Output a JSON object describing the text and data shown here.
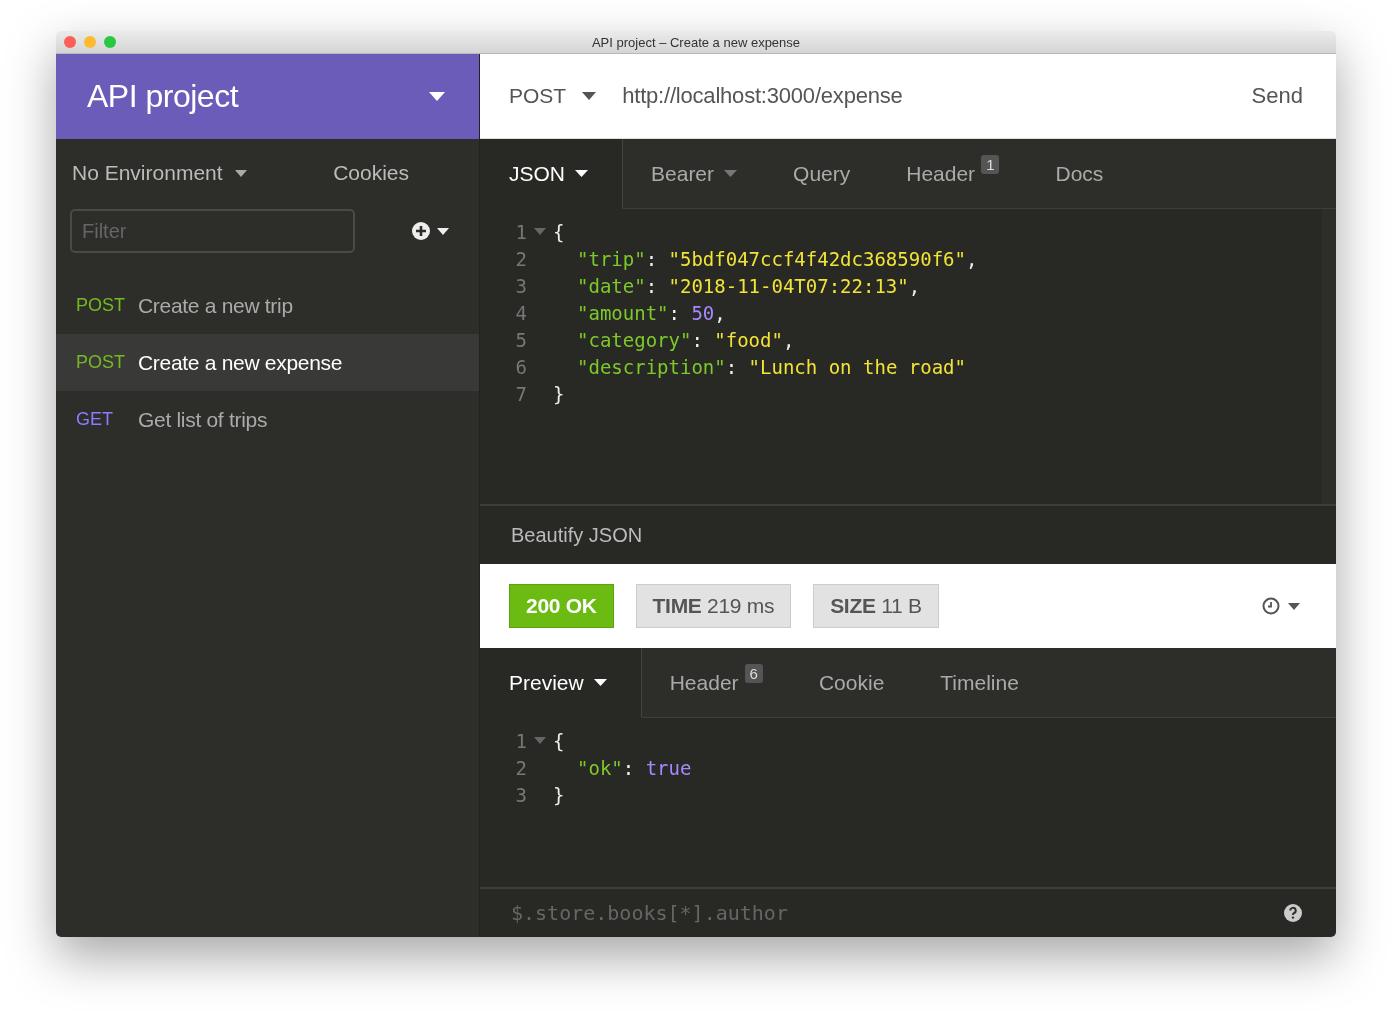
{
  "window": {
    "title": "API project – Create a new expense"
  },
  "sidebar": {
    "workspace": "API project",
    "environment": "No Environment",
    "cookies": "Cookies",
    "filter": {
      "placeholder": "Filter"
    },
    "requests": [
      {
        "method": "POST",
        "color": "#75ba24",
        "name": "Create a new trip",
        "selected": false
      },
      {
        "method": "POST",
        "color": "#75ba24",
        "name": "Create a new expense",
        "selected": true
      },
      {
        "method": "GET",
        "color": "#8a7dff",
        "name": "Get list of trips",
        "selected": false
      }
    ]
  },
  "url_bar": {
    "method": "POST",
    "url": "http://localhost:3000/expense",
    "send": "Send"
  },
  "request_tabs": [
    {
      "label": "JSON",
      "dropdown": true,
      "selected": true
    },
    {
      "label": "Bearer",
      "dropdown": true,
      "selected": false
    },
    {
      "label": "Query",
      "dropdown": false,
      "selected": false
    },
    {
      "label": "Header",
      "badge": "1",
      "dropdown": false,
      "selected": false
    },
    {
      "label": "Docs",
      "dropdown": false,
      "selected": false
    }
  ],
  "request_body": [
    {
      "number": "1",
      "foldable": true,
      "tokens": [
        {
          "kind": "punct",
          "text": "{"
        }
      ]
    },
    {
      "number": "2",
      "foldable": false,
      "tokens": [
        {
          "kind": "key",
          "text": "\"trip\""
        },
        {
          "kind": "punct",
          "text": ": "
        },
        {
          "kind": "string",
          "text": "\"5bdf047ccf4f42dc368590f6\""
        },
        {
          "kind": "punct",
          "text": ","
        }
      ]
    },
    {
      "number": "3",
      "foldable": false,
      "tokens": [
        {
          "kind": "key",
          "text": "\"date\""
        },
        {
          "kind": "punct",
          "text": ": "
        },
        {
          "kind": "string",
          "text": "\"2018-11-04T07:22:13\""
        },
        {
          "kind": "punct",
          "text": ","
        }
      ]
    },
    {
      "number": "4",
      "foldable": false,
      "tokens": [
        {
          "kind": "key",
          "text": "\"amount\""
        },
        {
          "kind": "punct",
          "text": ": "
        },
        {
          "kind": "number",
          "text": "50"
        },
        {
          "kind": "punct",
          "text": ","
        }
      ]
    },
    {
      "number": "5",
      "foldable": false,
      "tokens": [
        {
          "kind": "key",
          "text": "\"category\""
        },
        {
          "kind": "punct",
          "text": ": "
        },
        {
          "kind": "string",
          "text": "\"food\""
        },
        {
          "kind": "punct",
          "text": ","
        }
      ]
    },
    {
      "number": "6",
      "foldable": false,
      "tokens": [
        {
          "kind": "key",
          "text": "\"description\""
        },
        {
          "kind": "punct",
          "text": ": "
        },
        {
          "kind": "string",
          "text": "\"Lunch on the road\""
        }
      ]
    },
    {
      "number": "7",
      "foldable": false,
      "tokens": [
        {
          "kind": "punct",
          "text": "}"
        }
      ]
    }
  ],
  "beautify": "Beautify JSON",
  "response": {
    "status": "200 OK",
    "time": "**TIME** 219 ms",
    "size": "**SIZE** 11 B"
  },
  "response_tabs": [
    {
      "label": "Preview",
      "dropdown": true,
      "selected": true
    },
    {
      "label": "Header",
      "badge": "6",
      "dropdown": false,
      "selected": false
    },
    {
      "label": "Cookie",
      "dropdown": false,
      "selected": false
    },
    {
      "label": "Timeline",
      "dropdown": false,
      "selected": false
    }
  ],
  "response_body": [
    {
      "number": "1",
      "foldable": true,
      "tokens": [
        {
          "kind": "punct",
          "text": "{"
        }
      ]
    },
    {
      "number": "2",
      "foldable": false,
      "tokens": [
        {
          "kind": "key",
          "text": "\"ok\""
        },
        {
          "kind": "punct",
          "text": ": "
        },
        {
          "kind": "number",
          "text": "true"
        }
      ]
    },
    {
      "number": "3",
      "foldable": false,
      "tokens": [
        {
          "kind": "punct",
          "text": "}"
        }
      ]
    }
  ],
  "filter_query": {
    "placeholder": "$.store.books[*].author"
  }
}
